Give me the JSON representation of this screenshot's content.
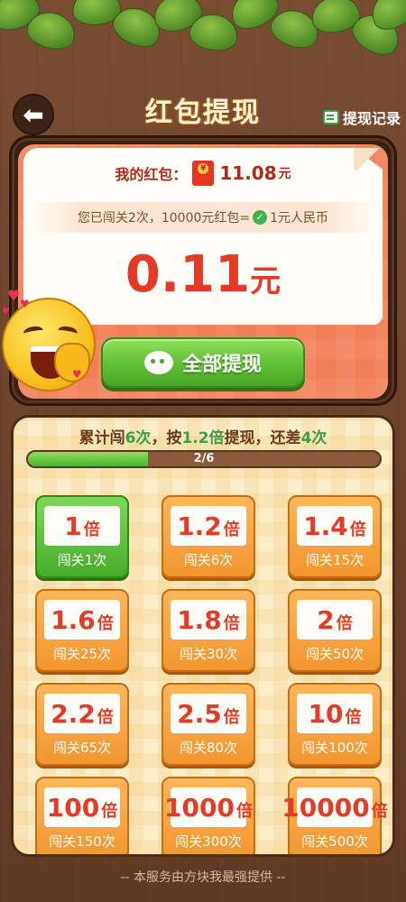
{
  "header": {
    "title": "红包提现",
    "record_label": "提现记录"
  },
  "balance": {
    "label": "我的红包：",
    "value": "11.08",
    "unit": "元"
  },
  "rate": {
    "text_before": "您已闯关2次，10000元红包=",
    "text_after": "1元人民币"
  },
  "amount": {
    "value": "0.11",
    "unit": "元"
  },
  "withdraw_button": {
    "label": "全部提现"
  },
  "progress": {
    "prefix": "累计闯",
    "count": "6次",
    "mid": "，按",
    "mult": "1.2倍",
    "mid2": "提现，还差",
    "remain": "4次",
    "label": "2/6",
    "fraction": 0.34
  },
  "tiles": [
    {
      "mult": "1",
      "x": "倍",
      "sub": "闯关1次",
      "done": true
    },
    {
      "mult": "1.2",
      "x": "倍",
      "sub": "闯关6次",
      "done": false
    },
    {
      "mult": "1.4",
      "x": "倍",
      "sub": "闯关15次",
      "done": false
    },
    {
      "mult": "1.6",
      "x": "倍",
      "sub": "闯关25次",
      "done": false
    },
    {
      "mult": "1.8",
      "x": "倍",
      "sub": "闯关30次",
      "done": false
    },
    {
      "mult": "2",
      "x": "倍",
      "sub": "闯关50次",
      "done": false
    },
    {
      "mult": "2.2",
      "x": "倍",
      "sub": "闯关65次",
      "done": false
    },
    {
      "mult": "2.5",
      "x": "倍",
      "sub": "闯关80次",
      "done": false
    },
    {
      "mult": "10",
      "x": "倍",
      "sub": "闯关100次",
      "done": false
    },
    {
      "mult": "100",
      "x": "倍",
      "sub": "闯关150次",
      "done": false
    },
    {
      "mult": "1000",
      "x": "倍",
      "sub": "闯关300次",
      "done": false
    },
    {
      "mult": "10000",
      "x": "倍",
      "sub": "闯关500次",
      "done": false
    }
  ],
  "footer": {
    "text": "-- 本服务由方块我最强提供 --"
  },
  "colors": {
    "accent_red": "#e43b27",
    "green": "#48a426",
    "tile_orange": "#f1962f",
    "wood": "#6e4630"
  },
  "icons": [
    "back-arrow-icon",
    "record-icon",
    "red-packet-icon",
    "check-icon",
    "wechat-icon",
    "emoji-mascot-icon"
  ]
}
